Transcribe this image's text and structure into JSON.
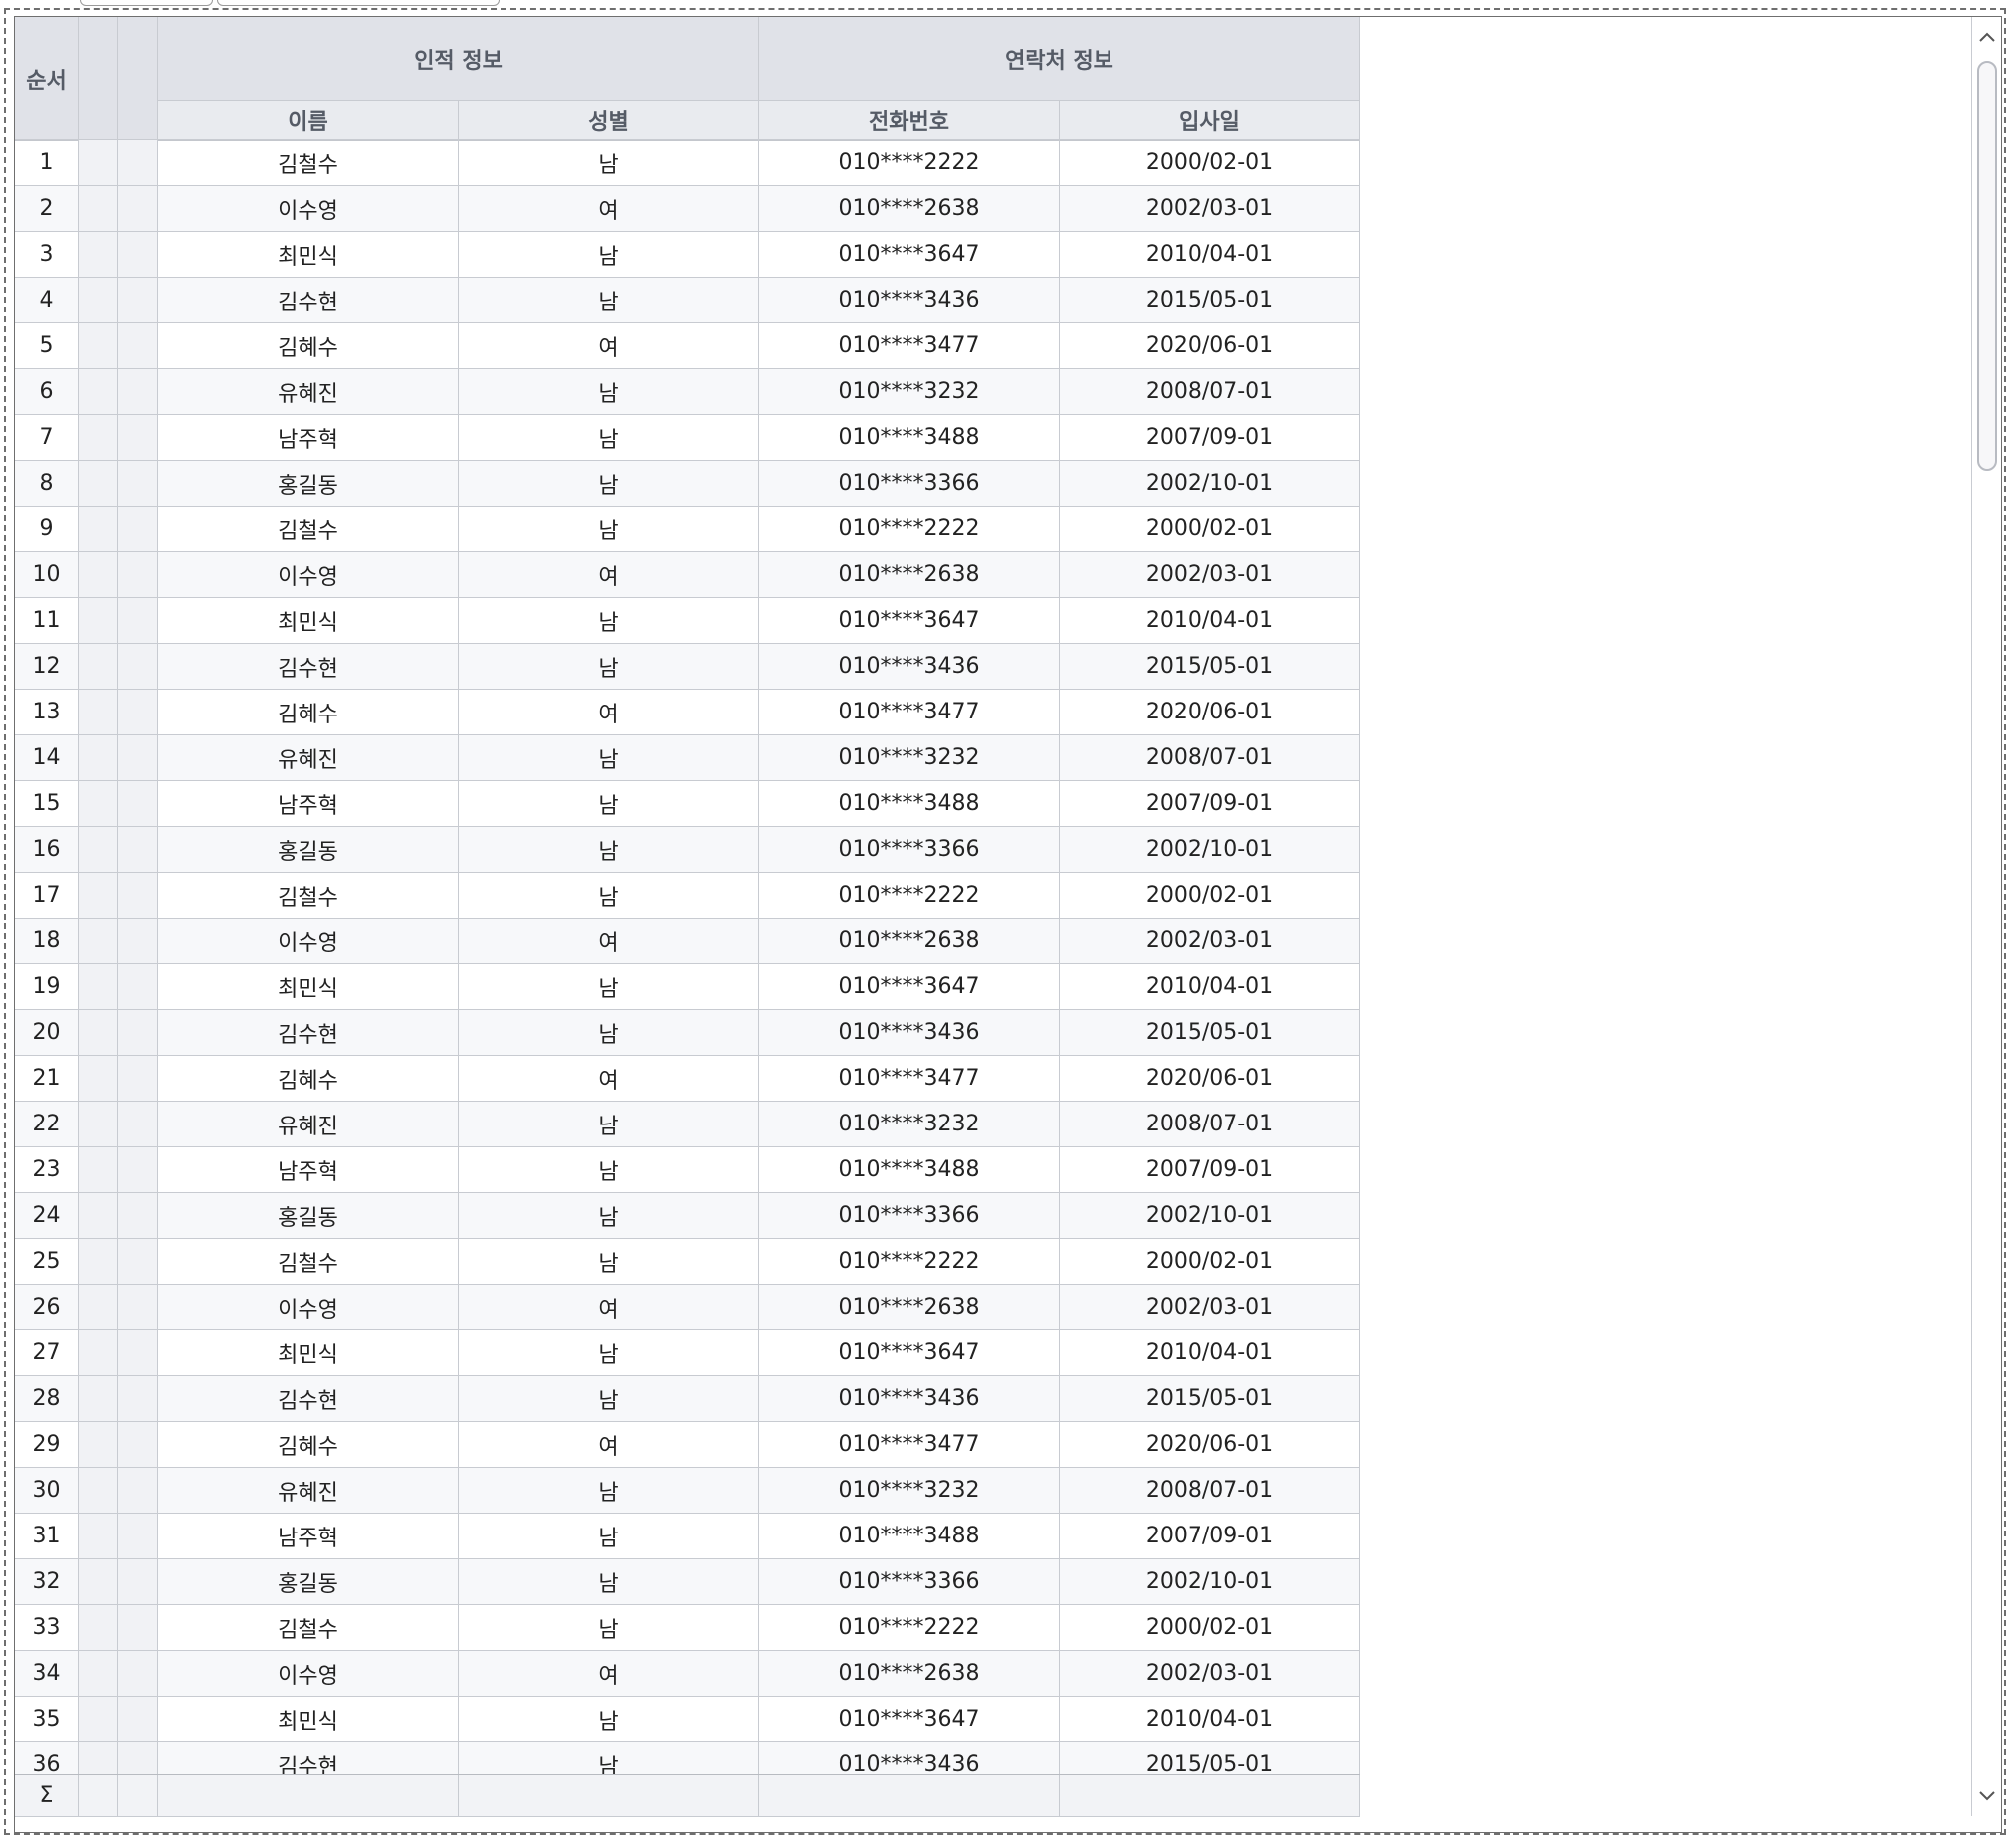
{
  "grid": {
    "header": {
      "seq": "순서",
      "groups": [
        "인적 정보",
        "연락처 정보"
      ],
      "columns": [
        "이름",
        "성별",
        "전화번호",
        "입사일"
      ]
    },
    "rows": [
      {
        "seq": "1",
        "name": "김철수",
        "gender": "남",
        "phone": "010****2222",
        "hire": "2000/02-01"
      },
      {
        "seq": "2",
        "name": "이수영",
        "gender": "여",
        "phone": "010****2638",
        "hire": "2002/03-01"
      },
      {
        "seq": "3",
        "name": "최민식",
        "gender": "남",
        "phone": "010****3647",
        "hire": "2010/04-01"
      },
      {
        "seq": "4",
        "name": "김수현",
        "gender": "남",
        "phone": "010****3436",
        "hire": "2015/05-01"
      },
      {
        "seq": "5",
        "name": "김혜수",
        "gender": "여",
        "phone": "010****3477",
        "hire": "2020/06-01"
      },
      {
        "seq": "6",
        "name": "유혜진",
        "gender": "남",
        "phone": "010****3232",
        "hire": "2008/07-01"
      },
      {
        "seq": "7",
        "name": "남주혁",
        "gender": "남",
        "phone": "010****3488",
        "hire": "2007/09-01"
      },
      {
        "seq": "8",
        "name": "홍길동",
        "gender": "남",
        "phone": "010****3366",
        "hire": "2002/10-01"
      },
      {
        "seq": "9",
        "name": "김철수",
        "gender": "남",
        "phone": "010****2222",
        "hire": "2000/02-01"
      },
      {
        "seq": "10",
        "name": "이수영",
        "gender": "여",
        "phone": "010****2638",
        "hire": "2002/03-01"
      },
      {
        "seq": "11",
        "name": "최민식",
        "gender": "남",
        "phone": "010****3647",
        "hire": "2010/04-01"
      },
      {
        "seq": "12",
        "name": "김수현",
        "gender": "남",
        "phone": "010****3436",
        "hire": "2015/05-01"
      },
      {
        "seq": "13",
        "name": "김혜수",
        "gender": "여",
        "phone": "010****3477",
        "hire": "2020/06-01"
      },
      {
        "seq": "14",
        "name": "유혜진",
        "gender": "남",
        "phone": "010****3232",
        "hire": "2008/07-01"
      },
      {
        "seq": "15",
        "name": "남주혁",
        "gender": "남",
        "phone": "010****3488",
        "hire": "2007/09-01"
      },
      {
        "seq": "16",
        "name": "홍길동",
        "gender": "남",
        "phone": "010****3366",
        "hire": "2002/10-01"
      },
      {
        "seq": "17",
        "name": "김철수",
        "gender": "남",
        "phone": "010****2222",
        "hire": "2000/02-01"
      },
      {
        "seq": "18",
        "name": "이수영",
        "gender": "여",
        "phone": "010****2638",
        "hire": "2002/03-01"
      },
      {
        "seq": "19",
        "name": "최민식",
        "gender": "남",
        "phone": "010****3647",
        "hire": "2010/04-01"
      },
      {
        "seq": "20",
        "name": "김수현",
        "gender": "남",
        "phone": "010****3436",
        "hire": "2015/05-01"
      },
      {
        "seq": "21",
        "name": "김혜수",
        "gender": "여",
        "phone": "010****3477",
        "hire": "2020/06-01"
      },
      {
        "seq": "22",
        "name": "유혜진",
        "gender": "남",
        "phone": "010****3232",
        "hire": "2008/07-01"
      },
      {
        "seq": "23",
        "name": "남주혁",
        "gender": "남",
        "phone": "010****3488",
        "hire": "2007/09-01"
      },
      {
        "seq": "24",
        "name": "홍길동",
        "gender": "남",
        "phone": "010****3366",
        "hire": "2002/10-01"
      },
      {
        "seq": "25",
        "name": "김철수",
        "gender": "남",
        "phone": "010****2222",
        "hire": "2000/02-01"
      },
      {
        "seq": "26",
        "name": "이수영",
        "gender": "여",
        "phone": "010****2638",
        "hire": "2002/03-01"
      },
      {
        "seq": "27",
        "name": "최민식",
        "gender": "남",
        "phone": "010****3647",
        "hire": "2010/04-01"
      },
      {
        "seq": "28",
        "name": "김수현",
        "gender": "남",
        "phone": "010****3436",
        "hire": "2015/05-01"
      },
      {
        "seq": "29",
        "name": "김혜수",
        "gender": "여",
        "phone": "010****3477",
        "hire": "2020/06-01"
      },
      {
        "seq": "30",
        "name": "유혜진",
        "gender": "남",
        "phone": "010****3232",
        "hire": "2008/07-01"
      },
      {
        "seq": "31",
        "name": "남주혁",
        "gender": "남",
        "phone": "010****3488",
        "hire": "2007/09-01"
      },
      {
        "seq": "32",
        "name": "홍길동",
        "gender": "남",
        "phone": "010****3366",
        "hire": "2002/10-01"
      },
      {
        "seq": "33",
        "name": "김철수",
        "gender": "남",
        "phone": "010****2222",
        "hire": "2000/02-01"
      },
      {
        "seq": "34",
        "name": "이수영",
        "gender": "여",
        "phone": "010****2638",
        "hire": "2002/03-01"
      },
      {
        "seq": "35",
        "name": "최민식",
        "gender": "남",
        "phone": "010****3647",
        "hire": "2010/04-01"
      },
      {
        "seq": "36",
        "name": "김수현",
        "gender": "남",
        "phone": "010****3436",
        "hire": "2015/05-01"
      }
    ],
    "footer": {
      "sum_symbol": "Σ"
    },
    "scrollbar": {
      "up_icon": "chevron-up-icon",
      "down_icon": "chevron-down-icon"
    },
    "colors": {
      "header_bg": "#e0e2e8",
      "alt_row_bg": "#f7f8fa",
      "grid_line": "#c8cbd1"
    }
  }
}
